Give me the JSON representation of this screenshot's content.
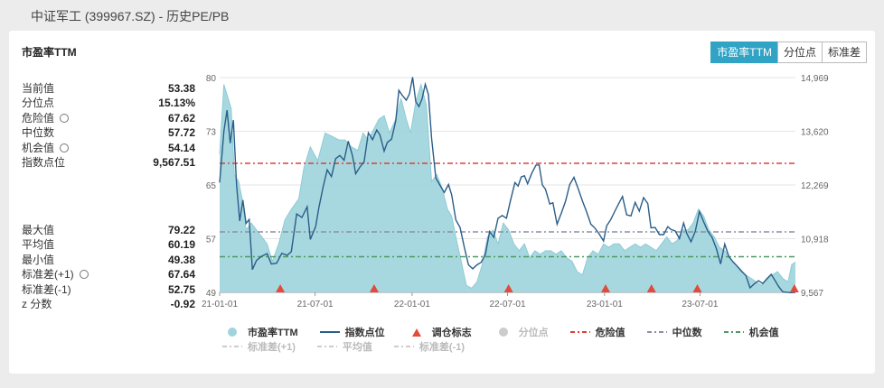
{
  "header": {
    "title": "中证军工 (399967.SZ) - 历史PE/PB"
  },
  "card": {
    "title": "市盈率TTM"
  },
  "tabs": [
    {
      "label": "市盈率TTM",
      "active": true
    },
    {
      "label": "分位点",
      "active": false
    },
    {
      "label": "标准差",
      "active": false
    }
  ],
  "stats_top": [
    {
      "label": "当前值",
      "value": "53.38",
      "gear": false
    },
    {
      "label": "分位点",
      "value": "15.13%",
      "gear": false
    },
    {
      "label": "危险值",
      "value": "67.62",
      "gear": true
    },
    {
      "label": "中位数",
      "value": "57.72",
      "gear": false
    },
    {
      "label": "机会值",
      "value": "54.14",
      "gear": true
    },
    {
      "label": "指数点位",
      "value": "9,567.51",
      "gear": false
    }
  ],
  "stats_bottom": [
    {
      "label": "最大值",
      "value": "79.22",
      "gear": false
    },
    {
      "label": "平均值",
      "value": "60.19",
      "gear": false
    },
    {
      "label": "最小值",
      "value": "49.38",
      "gear": false
    },
    {
      "label": "标准差(+1)",
      "value": "67.64",
      "gear": true
    },
    {
      "label": "标准差(-1)",
      "value": "52.75",
      "gear": false
    },
    {
      "label": "z 分数",
      "value": "-0.92",
      "gear": false
    }
  ],
  "colors": {
    "pe_fill": "#9fd4dc",
    "pe_line": "#8ccbd6",
    "index_line": "#2a5d88",
    "danger": "#d9403a",
    "median": "#8a8fa3",
    "opportunity": "#4b9a62",
    "marker": "#e24a3b",
    "accent": "#31a3c4"
  },
  "chart_data": {
    "type": "area",
    "left_axis": {
      "ticks": [
        "49",
        "57",
        "65",
        "73",
        "80"
      ],
      "range": [
        49,
        80
      ]
    },
    "right_axis": {
      "ticks": [
        "9,567",
        "10,918",
        "12,269",
        "13,620",
        "14,969"
      ],
      "range": [
        9567,
        14969
      ]
    },
    "x_ticks": [
      {
        "label": "21-01-01",
        "t": 0
      },
      {
        "label": "21-07-01",
        "t": 181
      },
      {
        "label": "22-01-01",
        "t": 365
      },
      {
        "label": "22-07-01",
        "t": 546
      },
      {
        "label": "23-01-01",
        "t": 730
      },
      {
        "label": "23-07-01",
        "t": 911
      }
    ],
    "t_max": 1092,
    "reference_lines": {
      "danger": 67.62,
      "median": 57.72,
      "opportunity": 54.14
    },
    "series": [
      {
        "name": "市盈率TTM",
        "points": [
          [
            0,
            69
          ],
          [
            8,
            79
          ],
          [
            14,
            77.5
          ],
          [
            22,
            75.5
          ],
          [
            28,
            66
          ],
          [
            36,
            65
          ],
          [
            44,
            62
          ],
          [
            50,
            58
          ],
          [
            60,
            59
          ],
          [
            70,
            58
          ],
          [
            80,
            57
          ],
          [
            90,
            56
          ],
          [
            100,
            53.5
          ],
          [
            112,
            56
          ],
          [
            124,
            59.5
          ],
          [
            136,
            61
          ],
          [
            150,
            62.5
          ],
          [
            160,
            67
          ],
          [
            172,
            70
          ],
          [
            186,
            68
          ],
          [
            200,
            72
          ],
          [
            214,
            71.5
          ],
          [
            226,
            71
          ],
          [
            238,
            71
          ],
          [
            250,
            70
          ],
          [
            262,
            69.5
          ],
          [
            272,
            72
          ],
          [
            282,
            71
          ],
          [
            292,
            72.5
          ],
          [
            302,
            74
          ],
          [
            312,
            74.5
          ],
          [
            322,
            72
          ],
          [
            334,
            74
          ],
          [
            344,
            77
          ],
          [
            354,
            74
          ],
          [
            362,
            72
          ],
          [
            372,
            76.5
          ],
          [
            382,
            79
          ],
          [
            392,
            76
          ],
          [
            402,
            65
          ],
          [
            412,
            66
          ],
          [
            422,
            64
          ],
          [
            432,
            61
          ],
          [
            440,
            60
          ],
          [
            448,
            57
          ],
          [
            458,
            53.5
          ],
          [
            468,
            50
          ],
          [
            478,
            49.6
          ],
          [
            488,
            50.5
          ],
          [
            498,
            53
          ],
          [
            508,
            57
          ],
          [
            518,
            58
          ],
          [
            528,
            56
          ],
          [
            538,
            59
          ],
          [
            548,
            58
          ],
          [
            558,
            56
          ],
          [
            568,
            55
          ],
          [
            578,
            56
          ],
          [
            588,
            54
          ],
          [
            598,
            55
          ],
          [
            608,
            54.5
          ],
          [
            618,
            55
          ],
          [
            628,
            55
          ],
          [
            638,
            54.5
          ],
          [
            648,
            55
          ],
          [
            658,
            54
          ],
          [
            668,
            53.5
          ],
          [
            678,
            52
          ],
          [
            688,
            51.5
          ],
          [
            698,
            54
          ],
          [
            708,
            55
          ],
          [
            718,
            54.5
          ],
          [
            728,
            56
          ],
          [
            738,
            55.5
          ],
          [
            748,
            56
          ],
          [
            758,
            56
          ],
          [
            768,
            55
          ],
          [
            778,
            55.5
          ],
          [
            788,
            56
          ],
          [
            798,
            55.5
          ],
          [
            808,
            56
          ],
          [
            818,
            55.5
          ],
          [
            828,
            55
          ],
          [
            838,
            56
          ],
          [
            848,
            57
          ],
          [
            858,
            56
          ],
          [
            868,
            56.5
          ],
          [
            878,
            58
          ],
          [
            888,
            58
          ],
          [
            898,
            59
          ],
          [
            908,
            61
          ],
          [
            918,
            60
          ],
          [
            928,
            58
          ],
          [
            938,
            57
          ],
          [
            948,
            55.5
          ],
          [
            958,
            55
          ],
          [
            968,
            54
          ],
          [
            978,
            53
          ],
          [
            988,
            52
          ],
          [
            998,
            51.5
          ],
          [
            1008,
            51
          ],
          [
            1018,
            50.5
          ],
          [
            1028,
            50
          ],
          [
            1038,
            50.8
          ],
          [
            1048,
            51.5
          ],
          [
            1058,
            52
          ],
          [
            1068,
            51
          ],
          [
            1078,
            50.5
          ],
          [
            1085,
            53
          ],
          [
            1092,
            53.38
          ]
        ]
      },
      {
        "name": "指数点位",
        "points": [
          [
            0,
            12330
          ],
          [
            8,
            13620
          ],
          [
            14,
            14150
          ],
          [
            20,
            13320
          ],
          [
            26,
            13900
          ],
          [
            32,
            12280
          ],
          [
            38,
            11360
          ],
          [
            44,
            11890
          ],
          [
            50,
            11300
          ],
          [
            56,
            11400
          ],
          [
            62,
            10140
          ],
          [
            70,
            10370
          ],
          [
            80,
            10480
          ],
          [
            90,
            10540
          ],
          [
            98,
            10280
          ],
          [
            108,
            10300
          ],
          [
            118,
            10550
          ],
          [
            128,
            10500
          ],
          [
            136,
            10590
          ],
          [
            146,
            11540
          ],
          [
            156,
            11450
          ],
          [
            166,
            11720
          ],
          [
            172,
            10900
          ],
          [
            182,
            11220
          ],
          [
            188,
            11690
          ],
          [
            196,
            12200
          ],
          [
            204,
            12650
          ],
          [
            212,
            12480
          ],
          [
            220,
            12930
          ],
          [
            228,
            13010
          ],
          [
            236,
            12890
          ],
          [
            244,
            13370
          ],
          [
            252,
            13000
          ],
          [
            258,
            12550
          ],
          [
            266,
            12720
          ],
          [
            274,
            12850
          ],
          [
            282,
            13580
          ],
          [
            290,
            13410
          ],
          [
            298,
            13650
          ],
          [
            304,
            13530
          ],
          [
            312,
            13120
          ],
          [
            318,
            13340
          ],
          [
            326,
            13420
          ],
          [
            334,
            13880
          ],
          [
            340,
            14650
          ],
          [
            346,
            14530
          ],
          [
            354,
            14400
          ],
          [
            360,
            14560
          ],
          [
            366,
            14980
          ],
          [
            372,
            14360
          ],
          [
            378,
            14240
          ],
          [
            384,
            14440
          ],
          [
            390,
            14800
          ],
          [
            396,
            14540
          ],
          [
            402,
            13440
          ],
          [
            410,
            12440
          ],
          [
            418,
            12260
          ],
          [
            426,
            12080
          ],
          [
            434,
            12280
          ],
          [
            440,
            12020
          ],
          [
            448,
            11390
          ],
          [
            456,
            11200
          ],
          [
            464,
            10700
          ],
          [
            472,
            10260
          ],
          [
            480,
            10160
          ],
          [
            488,
            10260
          ],
          [
            496,
            10320
          ],
          [
            504,
            10520
          ],
          [
            512,
            11100
          ],
          [
            520,
            10950
          ],
          [
            528,
            11430
          ],
          [
            536,
            11500
          ],
          [
            544,
            11430
          ],
          [
            552,
            11900
          ],
          [
            560,
            12330
          ],
          [
            566,
            12240
          ],
          [
            572,
            12470
          ],
          [
            578,
            12500
          ],
          [
            584,
            12300
          ],
          [
            592,
            12560
          ],
          [
            600,
            12770
          ],
          [
            606,
            12770
          ],
          [
            612,
            12270
          ],
          [
            618,
            12160
          ],
          [
            626,
            11790
          ],
          [
            632,
            11820
          ],
          [
            640,
            11280
          ],
          [
            648,
            11560
          ],
          [
            656,
            11860
          ],
          [
            664,
            12280
          ],
          [
            672,
            12460
          ],
          [
            680,
            12170
          ],
          [
            688,
            11870
          ],
          [
            696,
            11590
          ],
          [
            704,
            11280
          ],
          [
            712,
            11180
          ],
          [
            720,
            11030
          ],
          [
            728,
            10860
          ],
          [
            734,
            11240
          ],
          [
            742,
            11400
          ],
          [
            750,
            11620
          ],
          [
            758,
            11830
          ],
          [
            764,
            11980
          ],
          [
            772,
            11520
          ],
          [
            780,
            11490
          ],
          [
            788,
            11830
          ],
          [
            796,
            11610
          ],
          [
            804,
            11950
          ],
          [
            812,
            11800
          ],
          [
            818,
            11190
          ],
          [
            826,
            11200
          ],
          [
            834,
            11020
          ],
          [
            842,
            11020
          ],
          [
            850,
            11220
          ],
          [
            856,
            11150
          ],
          [
            864,
            11110
          ],
          [
            872,
            10920
          ],
          [
            880,
            11310
          ],
          [
            886,
            11050
          ],
          [
            894,
            10840
          ],
          [
            902,
            11100
          ],
          [
            910,
            11600
          ],
          [
            918,
            11340
          ],
          [
            926,
            11100
          ],
          [
            934,
            10950
          ],
          [
            942,
            10670
          ],
          [
            950,
            10280
          ],
          [
            958,
            10780
          ],
          [
            966,
            10460
          ],
          [
            974,
            10330
          ],
          [
            982,
            10220
          ],
          [
            990,
            10100
          ],
          [
            998,
            9990
          ],
          [
            1006,
            9680
          ],
          [
            1014,
            9780
          ],
          [
            1022,
            9860
          ],
          [
            1030,
            9790
          ],
          [
            1038,
            9910
          ],
          [
            1046,
            10020
          ],
          [
            1054,
            9850
          ],
          [
            1060,
            9720
          ],
          [
            1068,
            9580
          ],
          [
            1076,
            9570
          ],
          [
            1084,
            9560
          ],
          [
            1092,
            9567.51
          ]
        ]
      }
    ],
    "rebalance_markers": [
      115,
      293,
      548,
      732,
      819,
      906,
      1090
    ],
    "legend": [
      {
        "label": "市盈率TTM",
        "kind": "dot",
        "color": "#9fd4dc",
        "active": true
      },
      {
        "label": "指数点位",
        "kind": "line",
        "color": "#2a5d88",
        "active": true
      },
      {
        "label": "调仓标志",
        "kind": "triangle",
        "color": "#e24a3b",
        "active": true
      },
      {
        "label": "分位点",
        "kind": "dot",
        "color": "#cccccc",
        "active": false
      },
      {
        "label": "危险值",
        "kind": "dash",
        "color": "#d9403a",
        "active": true
      },
      {
        "label": "中位数",
        "kind": "dash",
        "color": "#8a8fa3",
        "active": true
      },
      {
        "label": "机会值",
        "kind": "dash",
        "color": "#4b9a62",
        "active": true
      },
      {
        "label": "标准差(+1)",
        "kind": "dash",
        "color": "#cccccc",
        "active": false
      },
      {
        "label": "平均值",
        "kind": "dash",
        "color": "#cccccc",
        "active": false
      },
      {
        "label": "标准差(-1)",
        "kind": "dash",
        "color": "#cccccc",
        "active": false
      }
    ]
  }
}
